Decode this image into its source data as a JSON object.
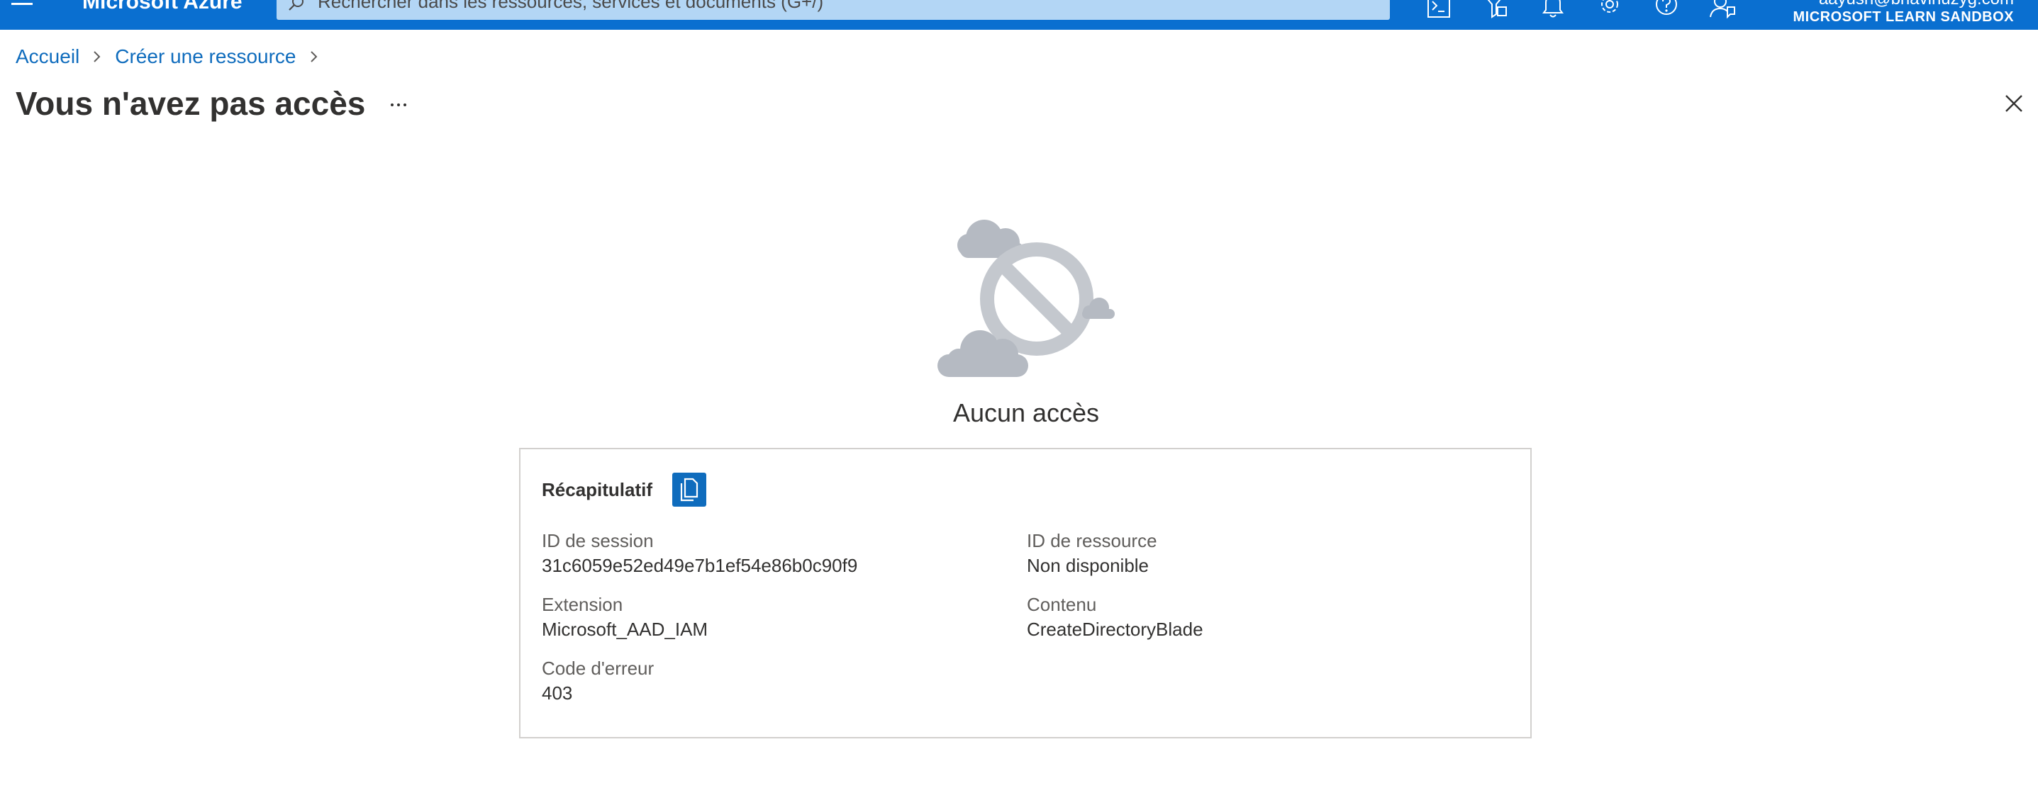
{
  "app": {
    "brand": "Microsoft Azure"
  },
  "search": {
    "placeholder": "Rechercher dans les ressources, services et documents (G+/)"
  },
  "user": {
    "email": "aayush@bhavinuzyg.com",
    "tenant": "MICROSOFT LEARN SANDBOX"
  },
  "breadcrumb": {
    "items": [
      {
        "label": "Accueil"
      },
      {
        "label": "Créer une ressource"
      }
    ]
  },
  "page": {
    "title": "Vous n'avez pas accès",
    "more_label": "···"
  },
  "status": {
    "title": "Aucun accès"
  },
  "summary": {
    "title": "Récapitulatif",
    "fields": {
      "session_id": {
        "label": "ID de session",
        "value": "31c6059e52ed49e7b1ef54e86b0c90f9"
      },
      "resource_id": {
        "label": "ID de ressource",
        "value": "Non disponible"
      },
      "extension": {
        "label": "Extension",
        "value": "Microsoft_AAD_IAM"
      },
      "content": {
        "label": "Contenu",
        "value": "CreateDirectoryBlade"
      },
      "error_code": {
        "label": "Code d'erreur",
        "value": "403"
      }
    }
  },
  "colors": {
    "topbar": "#0a6fd0",
    "link": "#0f6cbd",
    "illustration_gray": "#b5bac2"
  },
  "icons": {
    "topbar": [
      "cloud-shell-icon",
      "directory-filter-icon",
      "notifications-icon",
      "settings-icon",
      "help-icon",
      "feedback-icon"
    ]
  }
}
